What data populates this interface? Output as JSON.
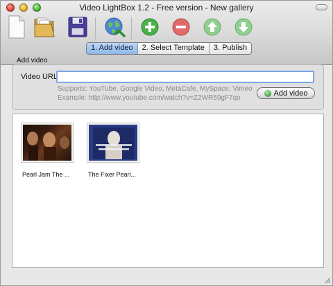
{
  "window": {
    "title": "Video LightBox 1.2 - Free version - New gallery"
  },
  "toolbar": {
    "icons": [
      "new-document-icon",
      "open-folder-icon",
      "save-icon",
      "publish-globe-icon",
      "add-icon",
      "remove-icon",
      "move-up-icon",
      "move-down-icon"
    ]
  },
  "tabs": [
    {
      "label": "1. Add video",
      "active": true
    },
    {
      "label": "2. Select Template",
      "active": false
    },
    {
      "label": "3. Publish",
      "active": false
    }
  ],
  "add_video": {
    "group_label": "Add video",
    "url_label": "Video URL",
    "url_value": "",
    "supports_text": "Supports: YouTube, Google Video, MetaCafe, MySpace, Vimeo",
    "example_text": "Example: http://www.youtube.com/watch?v=Z2WR59gF7qo",
    "add_button_label": "Add video"
  },
  "gallery": {
    "items": [
      {
        "caption": "Pearl Jam The ..."
      },
      {
        "caption": "The Fixer Pearl..."
      }
    ]
  },
  "colors": {
    "active_tab": "#9cc3ee",
    "input_focus": "#7aa7e6",
    "add_green": "#3d9e3d",
    "remove_red": "#d94040"
  }
}
